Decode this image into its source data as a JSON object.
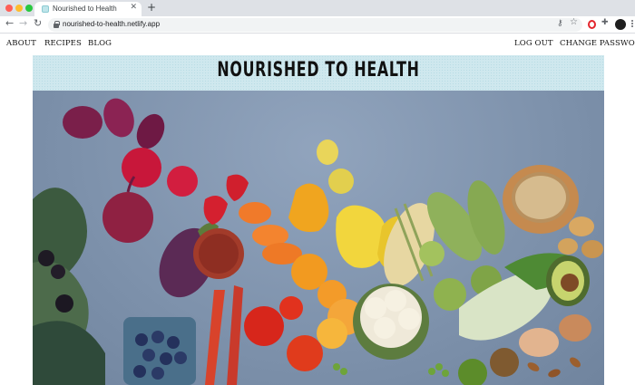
{
  "browser": {
    "tab": {
      "title": "Nourished to Health",
      "close_icon": "close-icon"
    },
    "new_tab_icon": "plus-icon",
    "url": "nourished-to-health.netlify.app",
    "icons": [
      "back-arrow-icon",
      "forward-arrow-icon",
      "reload-icon",
      "lock-icon",
      "key-icon",
      "star-icon",
      "opera-icon",
      "puzzle-icon",
      "profile-icon",
      "menu-dots-icon"
    ]
  },
  "nav": {
    "about": "ABOUT",
    "recipes": "RECIPES",
    "blog": "BLOG",
    "logout": "LOG OUT",
    "change_password": "CHANGE PASSWORD"
  },
  "header": {
    "title": "NOURISHED TO HEALTH",
    "background_color": "#cfe8ee"
  },
  "hero": {
    "background_color": "#7d91ab"
  }
}
